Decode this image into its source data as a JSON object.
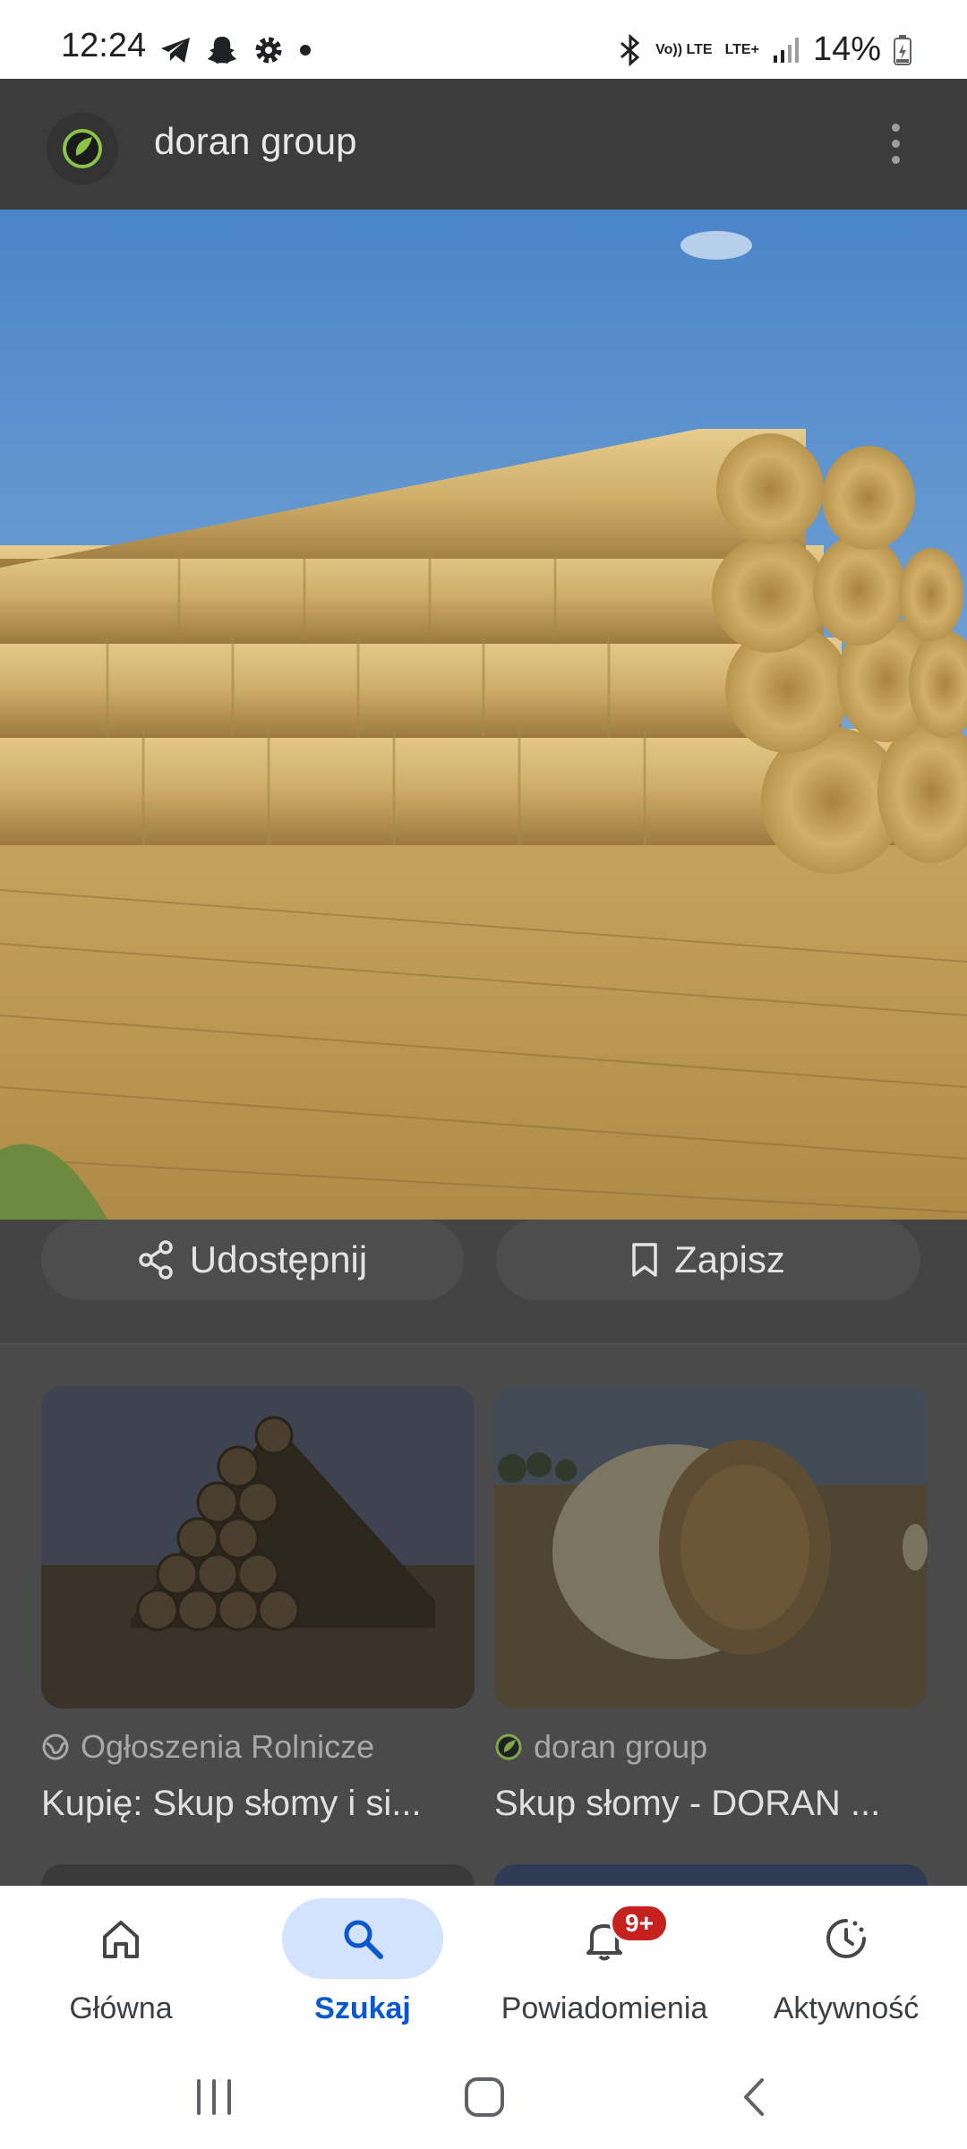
{
  "status_bar": {
    "time": "12:24",
    "battery": "14%",
    "network_top": "Vo)) LTE",
    "network_lte": "LTE+",
    "icons": [
      "telegram-icon",
      "snapchat-icon",
      "settings-icon",
      "dot-icon",
      "bluetooth-icon",
      "signal-icon",
      "battery-icon"
    ]
  },
  "app_bar": {
    "title": "doran group",
    "logo_icon": "doran-group-logo-icon",
    "menu_icon": "more-vert-icon"
  },
  "image_viewer": {
    "description_icon": "photo"
  },
  "actions": {
    "share_label": "Udostępnij",
    "save_label": "Zapisz"
  },
  "results": [
    {
      "source": "Ogłoszenia Rolnicze",
      "source_icon": "globe-icon",
      "title": "Kupię: Skup słomy i si..."
    },
    {
      "source": "doran group",
      "source_icon": "doran-group-logo-icon",
      "title": "Skup słomy - DORAN ..."
    }
  ],
  "bottom_nav": {
    "items": [
      {
        "label": "Główna",
        "icon": "home-icon"
      },
      {
        "label": "Szukaj",
        "icon": "search-icon",
        "active": true
      },
      {
        "label": "Powiadomienia",
        "icon": "bell-icon",
        "badge": "9+"
      },
      {
        "label": "Aktywność",
        "icon": "activity-icon"
      }
    ]
  },
  "colors": {
    "accent": "#0b57d0",
    "accent_bg": "#d3e3fd",
    "badge": "#c5221f",
    "logo_green": "#8bc34a"
  }
}
